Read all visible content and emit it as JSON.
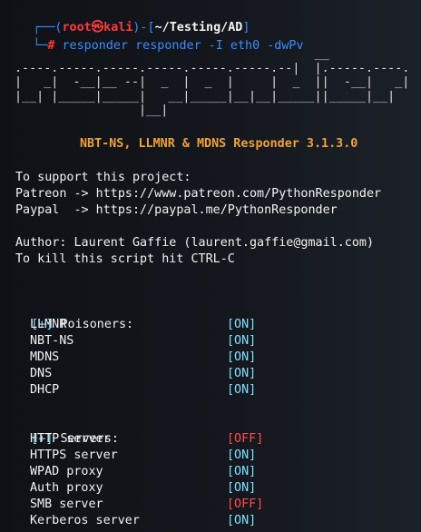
{
  "prompt": {
    "corner_top": "┌──(",
    "user": "root㉿kali",
    "mid": ")-[",
    "path": "~/Testing/AD",
    "end": "]",
    "corner_bottom": "└─",
    "hash": "# ",
    "command": "responder",
    "args": " responder -I eth0 -dwPv"
  },
  "ascii_logo": "                                         __\n.----.-----.-----.-----.-----.-----.--|  |.-----.----.\n|   _|  -__|__ --|  _  |  _  |     |  _  ||  -__|   _|\n|__| |_____|_____|   __|_____|__|__|_____||_____|__|\n                 |__|",
  "banner_title": "NBT-NS, LLMNR & MDNS Responder 3.1.3.0",
  "support": {
    "heading": "To support this project:",
    "patreon": "Patreon -> https://www.patreon.com/PythonResponder",
    "paypal": "Paypal  -> https://paypal.me/PythonResponder"
  },
  "author": "Author: Laurent Gaffie (laurent.gaffie@gmail.com)",
  "kill": "To kill this script hit CTRL-C",
  "poisoners": {
    "marker": "[+]",
    "heading": " Poisoners:",
    "items": [
      {
        "name": "LLMNR",
        "status": "[ON]"
      },
      {
        "name": "NBT-NS",
        "status": "[ON]"
      },
      {
        "name": "MDNS",
        "status": "[ON]"
      },
      {
        "name": "DNS",
        "status": "[ON]"
      },
      {
        "name": "DHCP",
        "status": "[ON]"
      }
    ]
  },
  "servers": {
    "marker": "[+]",
    "heading": " Servers:",
    "items": [
      {
        "name": "HTTP server",
        "status": "[OFF]"
      },
      {
        "name": "HTTPS server",
        "status": "[ON]"
      },
      {
        "name": "WPAD proxy",
        "status": "[ON]"
      },
      {
        "name": "Auth proxy",
        "status": "[ON]"
      },
      {
        "name": "SMB server",
        "status": "[OFF]"
      },
      {
        "name": "Kerberos server",
        "status": "[ON]"
      }
    ]
  }
}
